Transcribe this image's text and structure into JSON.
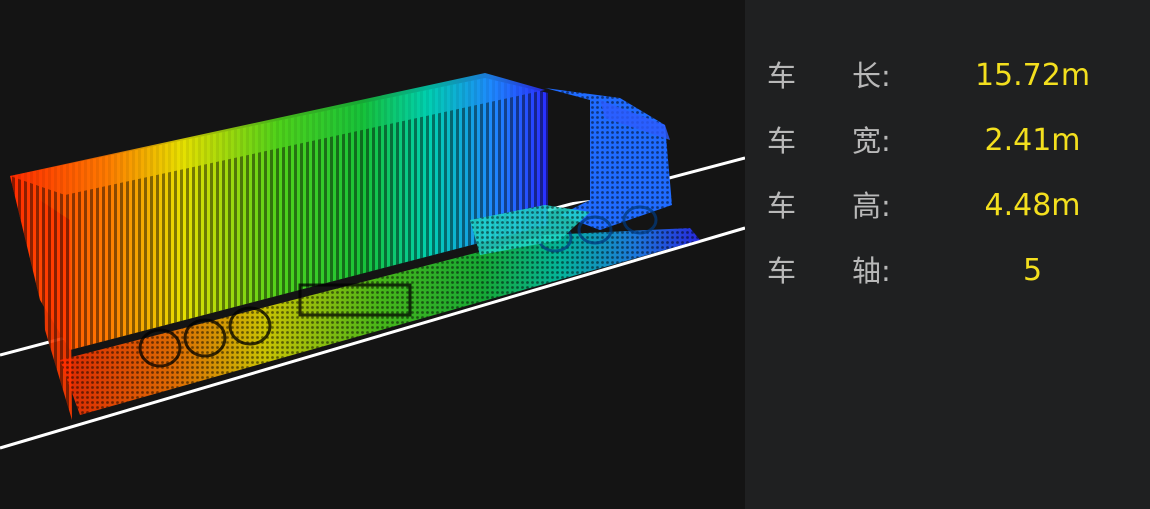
{
  "viewport": {
    "description_icon": "point-cloud-truck"
  },
  "measurements": [
    {
      "char": "车",
      "name": "长:",
      "value": "15.72m"
    },
    {
      "char": "车",
      "name": "宽:",
      "value": "2.41m"
    },
    {
      "char": "车",
      "name": "高:",
      "value": "4.48m"
    },
    {
      "char": "车",
      "name": "轴:",
      "value": "5"
    }
  ],
  "colors": {
    "background": "#141414",
    "panel": "#1f2021",
    "label": "#b8b8b8",
    "value": "#f3df1e",
    "lane_line": "#ffffff"
  }
}
